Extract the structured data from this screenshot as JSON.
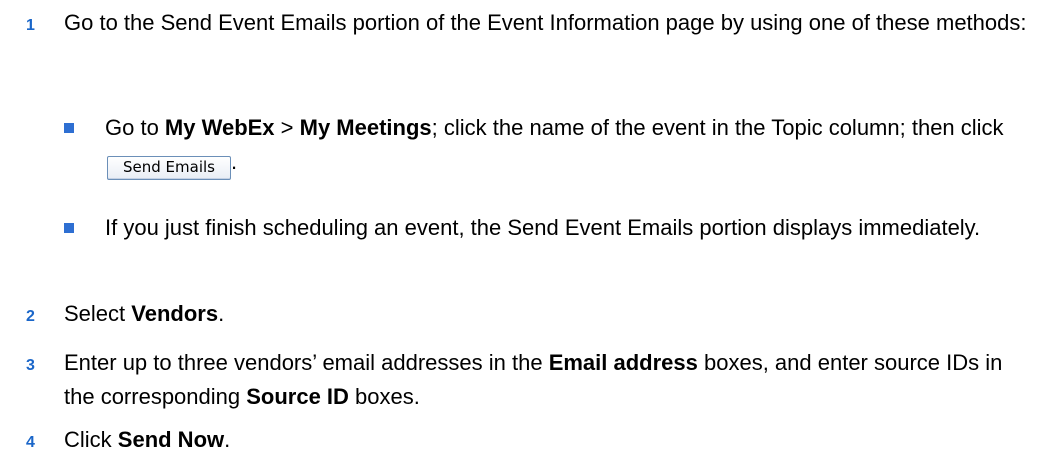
{
  "steps": [
    {
      "num": "1",
      "text": "Go to the Send Event Emails portion of the Event Information page by using one of these methods:",
      "bullets": [
        {
          "pre": "Go to ",
          "b1": "My WebEx",
          "sep": " > ",
          "b2": "My Meetings",
          "post": "; click the name of the event in the Topic column; then click ",
          "button": "Send Emails",
          "end": "."
        },
        {
          "text": "If you just finish scheduling an event, the Send Event Emails portion displays immediately."
        }
      ]
    },
    {
      "num": "2",
      "pre": "Select ",
      "bold": "Vendors",
      "post": "."
    },
    {
      "num": "3",
      "pre": "Enter up to three vendors’ email addresses in the ",
      "bold1": "Email address",
      "mid": " boxes, and enter source IDs in the corresponding ",
      "bold2": "Source ID",
      "post": " boxes."
    },
    {
      "num": "4",
      "pre": "Click ",
      "bold": "Send Now",
      "post": "."
    }
  ],
  "colors": {
    "step_number": "#1a66c9",
    "bullet": "#2e6fd2"
  }
}
